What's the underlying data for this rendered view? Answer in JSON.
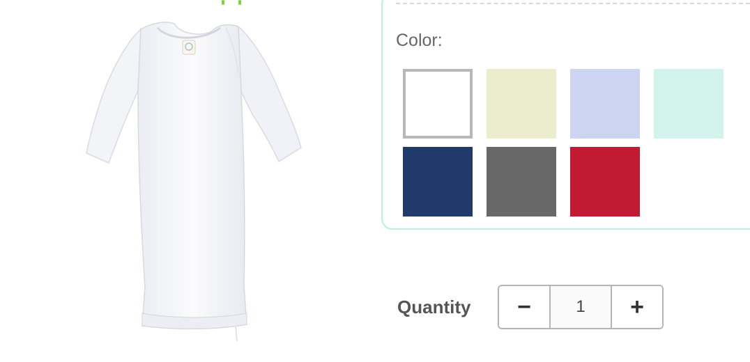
{
  "product": {
    "image_name": "white baby gown"
  },
  "options": {
    "color_label": "Color:",
    "swatches": [
      {
        "name": "white",
        "hex": "#ffffff",
        "selected": true
      },
      {
        "name": "cream",
        "hex": "#ecedcc",
        "selected": false
      },
      {
        "name": "lavender",
        "hex": "#cdd4f1",
        "selected": false
      },
      {
        "name": "mint",
        "hex": "#d3f4ec",
        "selected": false
      },
      {
        "name": "navy",
        "hex": "#1f3a6b",
        "selected": false
      },
      {
        "name": "gray",
        "hex": "#686868",
        "selected": false
      },
      {
        "name": "red",
        "hex": "#c21a33",
        "selected": false
      }
    ]
  },
  "quantity": {
    "label": "Quantity",
    "minus": "−",
    "value": "1",
    "plus": "+"
  },
  "colors": {
    "panel_border": "#bdeee3",
    "accent_green": "#7fd43a"
  }
}
